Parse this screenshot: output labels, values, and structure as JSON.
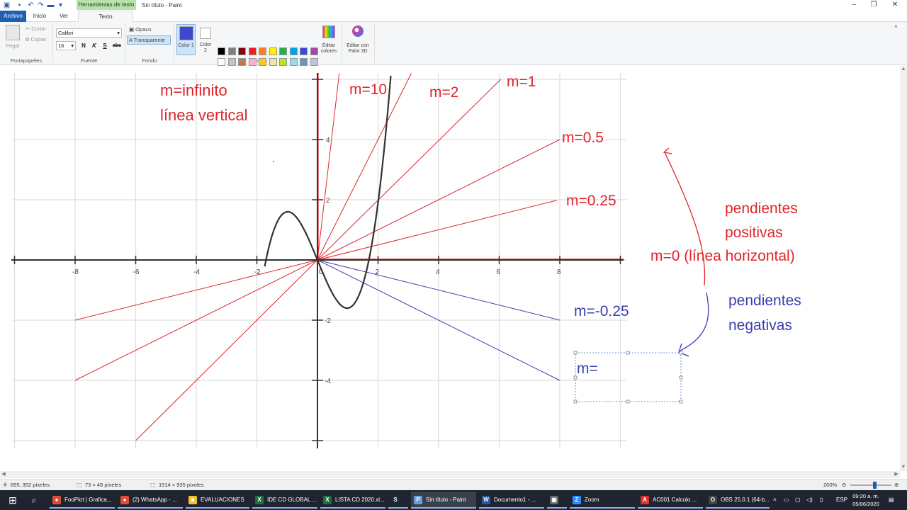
{
  "app": {
    "title": "Sin título - Paint",
    "contextual_tab": "Herramientas de texto"
  },
  "tabs": {
    "file": "Archivo",
    "home": "Inicio",
    "view": "Ver",
    "text": "Texto"
  },
  "ribbon": {
    "clipboard": {
      "paste": "Pegar",
      "cut": "Cortar",
      "copy": "Copiar",
      "group": "Portapapeles"
    },
    "font": {
      "family": "Calibri",
      "size": "16",
      "bold": "N",
      "italic": "K",
      "underline": "S",
      "strike": "abc",
      "group": "Fuente"
    },
    "background": {
      "opaque": "Opaco",
      "transparent": "Transparente",
      "group": "Fondo"
    },
    "colors": {
      "color1": "Color 1",
      "color2": "Color 2",
      "edit": "Editar colores",
      "group": "Colores",
      "color1_value": "#3f48cc",
      "color2_value": "#ffffff",
      "palette_row1": [
        "#000000",
        "#7f7f7f",
        "#880015",
        "#ed1c24",
        "#ff7f27",
        "#fff200",
        "#22b14c",
        "#00a2e8",
        "#3f48cc",
        "#a349a4"
      ],
      "palette_row2": [
        "#ffffff",
        "#c3c3c3",
        "#b97a57",
        "#ffaec9",
        "#ffc90e",
        "#efe4b0",
        "#b5e61d",
        "#99d9ea",
        "#7092be",
        "#c8bfe7"
      ]
    },
    "paint3d": "Editar con Paint 3D"
  },
  "canvas": {
    "annotations": {
      "m_infinito": "m=infinito",
      "linea_vertical": "línea vertical",
      "m10": "m=10",
      "m2": "m=2",
      "m1": "m=1",
      "m05": "m=0.5",
      "m025": "m=0.25",
      "pend_pos_1": "pendientes",
      "pend_pos_2": "positivas",
      "m0": "m=0 (línea horizontal)",
      "m_neg025": "m=-0.25",
      "pend_neg_1": "pendientes",
      "pend_neg_2": "negativas",
      "text_box": "m="
    },
    "x_ticks": [
      "-8",
      "-6",
      "-4",
      "-2",
      "0",
      "2",
      "4",
      "6",
      "8"
    ],
    "y_ticks": [
      "4",
      "2",
      "-2",
      "-4"
    ],
    "colors": {
      "positive": "#e0242b",
      "negative": "#3a3fb0",
      "curve": "#333333",
      "axis": "#333333",
      "grid": "#dddddd"
    }
  },
  "status": {
    "cursor": "655, 352 píxeles",
    "selection": "73 × 49 píxeles",
    "image_size": "1914 × 935 píxeles",
    "zoom": "200%"
  },
  "taskbar": {
    "items": [
      {
        "label": "FooPlot | Grafica...",
        "color": "#dd4b39",
        "glyph": "●"
      },
      {
        "label": "(2) WhatsApp - ...",
        "color": "#dd4b39",
        "glyph": "●"
      },
      {
        "label": "EVALUACIONES",
        "color": "#f2c233",
        "glyph": "■"
      },
      {
        "label": "IDE CD GLOBAL ...",
        "color": "#1d6f42",
        "glyph": "X"
      },
      {
        "label": "LISTA CD 2020.xl...",
        "color": "#1d6f42",
        "glyph": "X"
      },
      {
        "label": "",
        "color": "#1b2838",
        "glyph": "S"
      },
      {
        "label": "Sin título - Paint",
        "color": "#6aa0d8",
        "glyph": "P"
      },
      {
        "label": "Documento1 - ...",
        "color": "#2b579a",
        "glyph": "W"
      },
      {
        "label": "",
        "color": "#666666",
        "glyph": "▦"
      },
      {
        "label": "Zoom",
        "color": "#2d8cff",
        "glyph": "Z"
      },
      {
        "label": "AC001 Calculo ...",
        "color": "#d9342b",
        "glyph": "A"
      },
      {
        "label": "OBS 25.0.1 (64-b...",
        "color": "#444444",
        "glyph": "O"
      }
    ],
    "lang": "ESP",
    "time": "09:20 a. m.",
    "date": "05/06/2020"
  }
}
